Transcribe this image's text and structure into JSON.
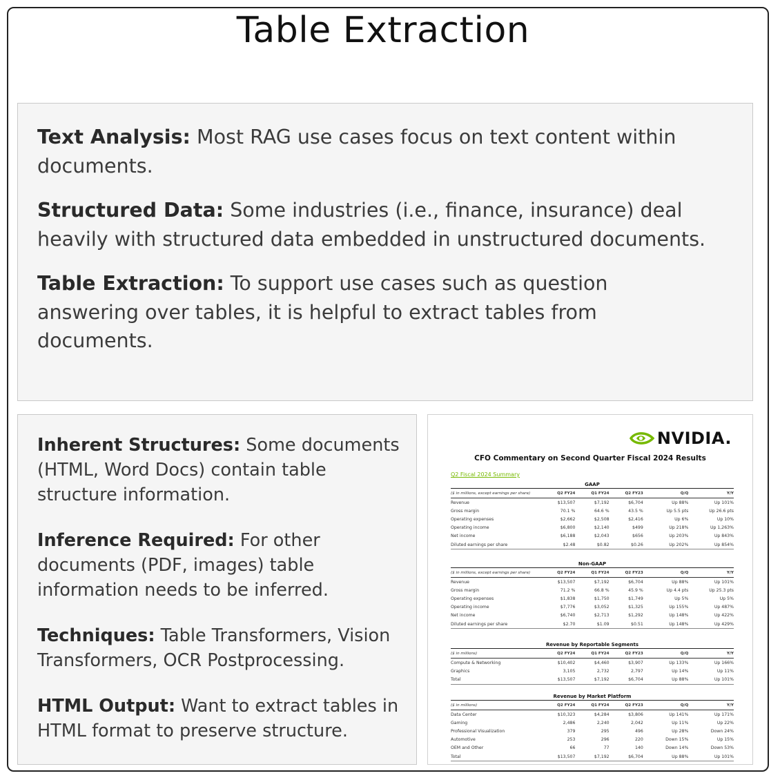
{
  "title": "Table Extraction",
  "top_box": [
    {
      "heading": "Text Analysis:",
      "text": " Most RAG use cases focus on text content within documents."
    },
    {
      "heading": "Structured Data:",
      "text": " Some industries (i.e., finance, insurance) deal heavily with structured data embedded in unstructured documents."
    },
    {
      "heading": "Table Extraction:",
      "text": " To support use cases such as question answering over tables, it is helpful to extract tables from documents."
    }
  ],
  "left_box": [
    {
      "heading": "Inherent Structures:",
      "text": " Some documents (HTML, Word Docs) contain table structure information."
    },
    {
      "heading": "Inference Required:",
      "text": " For other documents (PDF, images) table information needs to be inferred."
    },
    {
      "heading": "Techniques:",
      "text": " Table Transformers, Vision Transformers, OCR Postprocessing."
    },
    {
      "heading": "HTML Output:",
      "text": " Want to extract tables in HTML format to preserve structure."
    }
  ],
  "doc": {
    "logo_text": "NVIDIA.",
    "logo_color": "#76b900",
    "heading": "CFO Commentary on Second Quarter Fiscal 2024 Results",
    "link": "Q2 Fiscal 2024 Summary",
    "sections": [
      {
        "title": "GAAP",
        "columns": [
          "($ in millions, except earnings per share)",
          "Q2 FY24",
          "Q1 FY24",
          "Q2 FY23",
          "Q/Q",
          "Y/Y"
        ],
        "rows": [
          [
            "Revenue",
            "$13,507",
            "$7,192",
            "$6,704",
            "Up 88%",
            "Up 101%"
          ],
          [
            "Gross margin",
            "70.1 %",
            "64.6 %",
            "43.5 %",
            "Up 5.5 pts",
            "Up 26.6 pts"
          ],
          [
            "Operating expenses",
            "$2,662",
            "$2,508",
            "$2,416",
            "Up 6%",
            "Up 10%"
          ],
          [
            "Operating income",
            "$6,800",
            "$2,140",
            "$499",
            "Up 218%",
            "Up 1,263%"
          ],
          [
            "Net income",
            "$6,188",
            "$2,043",
            "$656",
            "Up 203%",
            "Up 843%"
          ],
          [
            "Diluted earnings per share",
            "$2.48",
            "$0.82",
            "$0.26",
            "Up 202%",
            "Up 854%"
          ]
        ]
      },
      {
        "title": "Non-GAAP",
        "columns": [
          "($ in millions, except earnings per share)",
          "Q2 FY24",
          "Q1 FY24",
          "Q2 FY23",
          "Q/Q",
          "Y/Y"
        ],
        "rows": [
          [
            "Revenue",
            "$13,507",
            "$7,192",
            "$6,704",
            "Up 88%",
            "Up 101%"
          ],
          [
            "Gross margin",
            "71.2 %",
            "66.8 %",
            "45.9 %",
            "Up 4.4 pts",
            "Up 25.3 pts"
          ],
          [
            "Operating expenses",
            "$1,838",
            "$1,750",
            "$1,749",
            "Up 5%",
            "Up 5%"
          ],
          [
            "Operating income",
            "$7,776",
            "$3,052",
            "$1,325",
            "Up 155%",
            "Up 487%"
          ],
          [
            "Net income",
            "$6,740",
            "$2,713",
            "$1,292",
            "Up 148%",
            "Up 422%"
          ],
          [
            "Diluted earnings per share",
            "$2.70",
            "$1.09",
            "$0.51",
            "Up 148%",
            "Up 429%"
          ]
        ]
      },
      {
        "title": "Revenue by Reportable Segments",
        "columns": [
          "($ in millions)",
          "Q2 FY24",
          "Q1 FY24",
          "Q2 FY23",
          "Q/Q",
          "Y/Y"
        ],
        "rows": [
          [
            "Compute & Networking",
            "$10,402",
            "$4,460",
            "$3,907",
            "Up 133%",
            "Up 166%"
          ],
          [
            "Graphics",
            "3,105",
            "2,732",
            "2,797",
            "Up 14%",
            "Up 11%"
          ],
          [
            "Total",
            "$13,507",
            "$7,192",
            "$6,704",
            "Up 88%",
            "Up 101%"
          ]
        ]
      },
      {
        "title": "Revenue by Market Platform",
        "columns": [
          "($ in millions)",
          "Q2 FY24",
          "Q1 FY24",
          "Q2 FY23",
          "Q/Q",
          "Y/Y"
        ],
        "rows": [
          [
            "Data Center",
            "$10,323",
            "$4,284",
            "$3,806",
            "Up 141%",
            "Up 171%"
          ],
          [
            "Gaming",
            "2,486",
            "2,240",
            "2,042",
            "Up 11%",
            "Up 22%"
          ],
          [
            "Professional Visualization",
            "379",
            "295",
            "496",
            "Up 28%",
            "Down 24%"
          ],
          [
            "Automotive",
            "253",
            "296",
            "220",
            "Down 15%",
            "Up 15%"
          ],
          [
            "OEM and Other",
            "66",
            "77",
            "140",
            "Down 14%",
            "Down 53%"
          ],
          [
            "Total",
            "$13,507",
            "$7,192",
            "$6,704",
            "Up 88%",
            "Up 101%"
          ]
        ]
      }
    ]
  }
}
